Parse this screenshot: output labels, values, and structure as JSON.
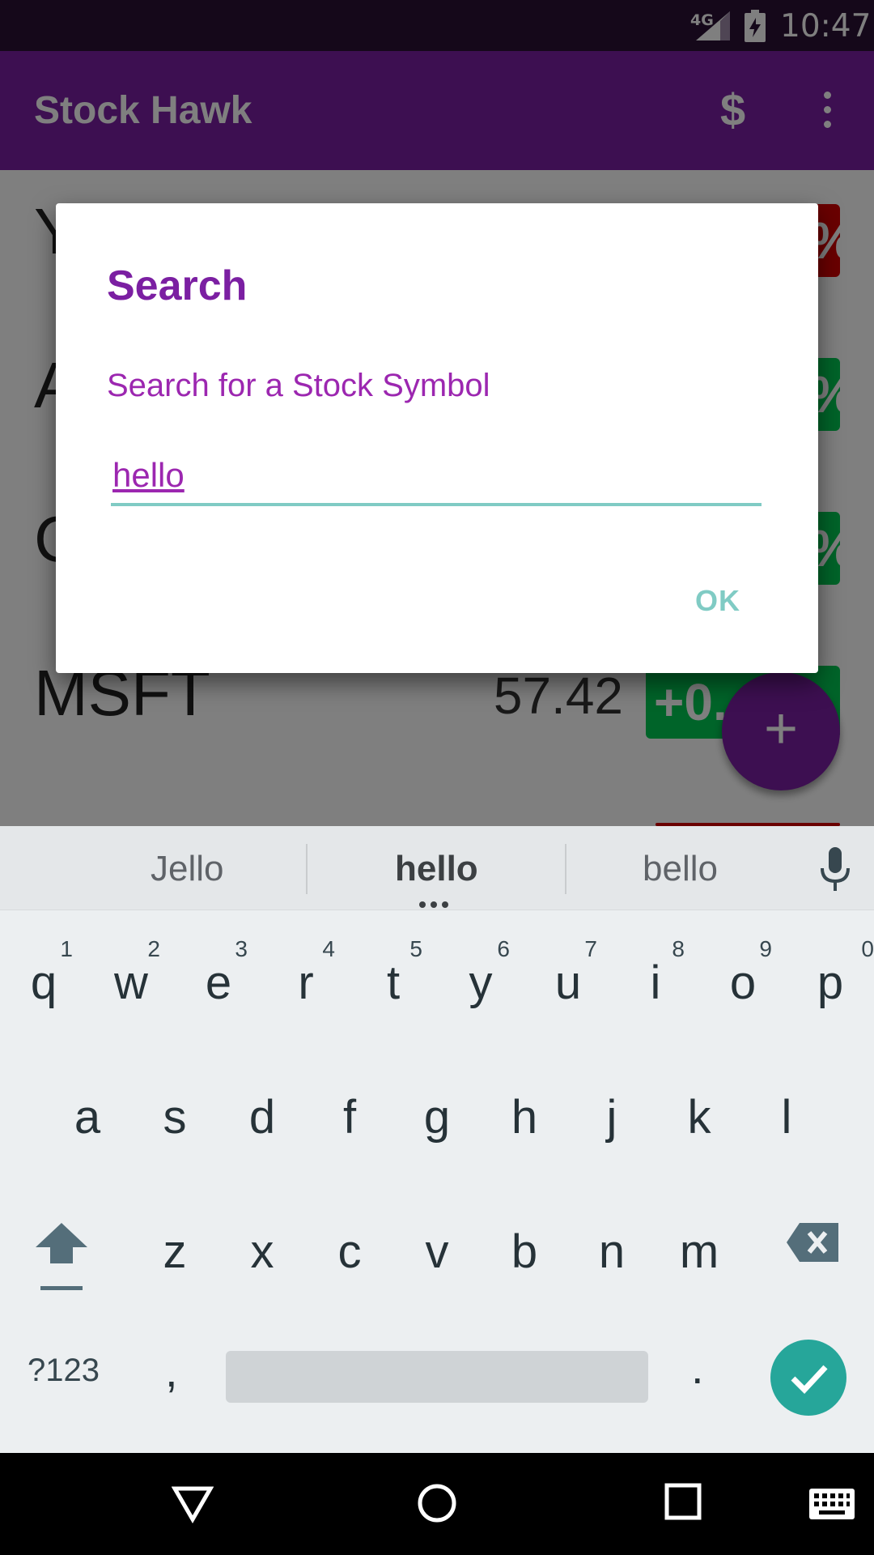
{
  "status_bar": {
    "network": "4G",
    "time": "10:47"
  },
  "app_bar": {
    "title": "Stock Hawk",
    "dollar_icon": "$"
  },
  "stocks": [
    {
      "symbol": "Y",
      "price": "",
      "change": "%",
      "direction": "down"
    },
    {
      "symbol": "A",
      "price": "",
      "change": "%",
      "direction": "up"
    },
    {
      "symbol": "C",
      "price": "",
      "change": "%",
      "direction": "up"
    },
    {
      "symbol": "MSFT",
      "price": "57.42",
      "change": "+0.",
      "direction": "up"
    }
  ],
  "fab": {
    "label": "+"
  },
  "dialog": {
    "title": "Search",
    "message": "Search for a Stock Symbol",
    "input_value": "hello",
    "ok_label": "OK"
  },
  "keyboard": {
    "suggestions": [
      "Jello",
      "hello",
      "bello"
    ],
    "row1": [
      {
        "ch": "q",
        "num": "1"
      },
      {
        "ch": "w",
        "num": "2"
      },
      {
        "ch": "e",
        "num": "3"
      },
      {
        "ch": "r",
        "num": "4"
      },
      {
        "ch": "t",
        "num": "5"
      },
      {
        "ch": "y",
        "num": "6"
      },
      {
        "ch": "u",
        "num": "7"
      },
      {
        "ch": "i",
        "num": "8"
      },
      {
        "ch": "o",
        "num": "9"
      },
      {
        "ch": "p",
        "num": "0"
      }
    ],
    "row2": [
      "a",
      "s",
      "d",
      "f",
      "g",
      "h",
      "j",
      "k",
      "l"
    ],
    "row3": [
      "z",
      "x",
      "c",
      "v",
      "b",
      "n",
      "m"
    ],
    "symbols_label": "?123",
    "comma": ",",
    "period": "."
  },
  "colors": {
    "primary": "#7b1fa2",
    "accent_teal": "#80cbc4",
    "up": "#00c853",
    "down": "#d50000"
  }
}
